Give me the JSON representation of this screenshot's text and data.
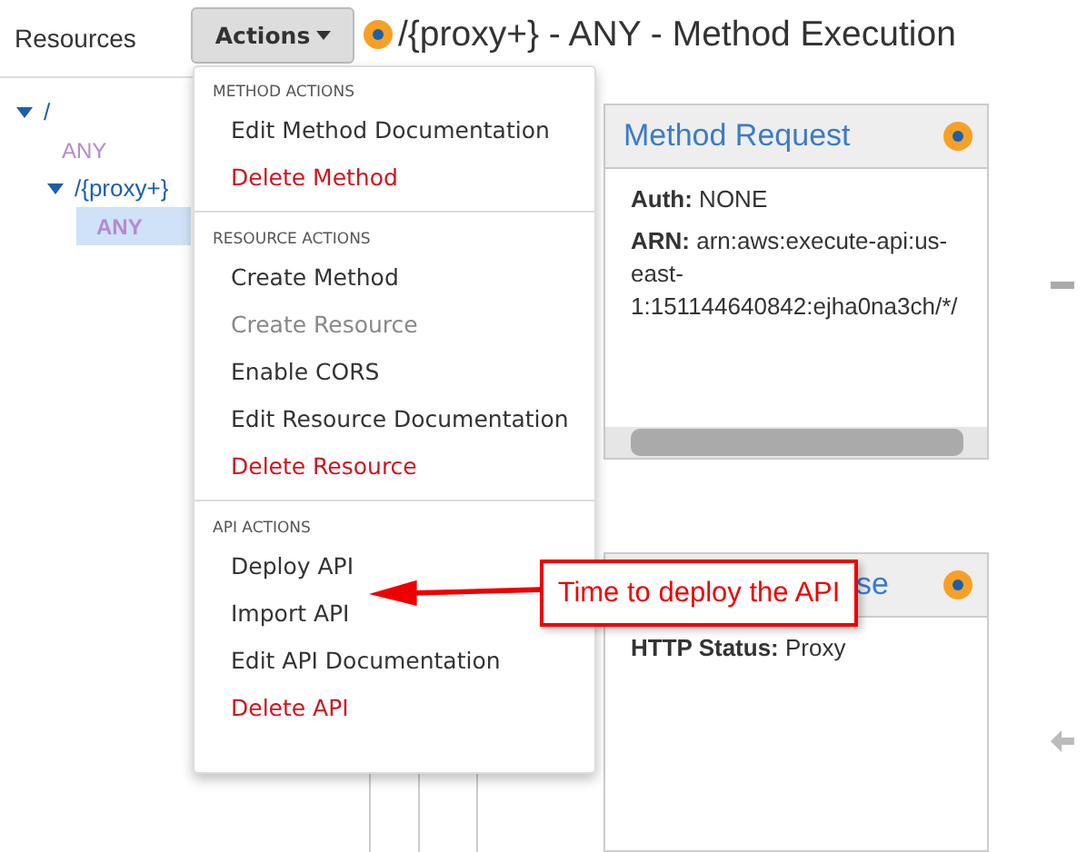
{
  "sidebar": {
    "title": "Resources",
    "tree": [
      {
        "label": "/",
        "kind": "resource",
        "expanded": true,
        "selected": false,
        "children": [
          {
            "label": "ANY",
            "kind": "method",
            "selected": false
          },
          {
            "label": "/{proxy+}",
            "kind": "resource",
            "expanded": true,
            "selected": false,
            "children": [
              {
                "label": "ANY",
                "kind": "method",
                "selected": true
              }
            ]
          }
        ]
      }
    ]
  },
  "actions_button": {
    "label": "Actions",
    "expanded": true
  },
  "page_title": "/{proxy+} - ANY - Method Execution",
  "actions_menu": [
    {
      "heading": "METHOD ACTIONS",
      "items": [
        {
          "label": "Edit Method Documentation",
          "danger": false,
          "disabled": false
        },
        {
          "label": "Delete Method",
          "danger": true,
          "disabled": false
        }
      ]
    },
    {
      "heading": "RESOURCE ACTIONS",
      "items": [
        {
          "label": "Create Method",
          "danger": false,
          "disabled": false
        },
        {
          "label": "Create Resource",
          "danger": false,
          "disabled": true
        },
        {
          "label": "Enable CORS",
          "danger": false,
          "disabled": false
        },
        {
          "label": "Edit Resource Documentation",
          "danger": false,
          "disabled": false
        },
        {
          "label": "Delete Resource",
          "danger": true,
          "disabled": false
        }
      ]
    },
    {
      "heading": "API ACTIONS",
      "items": [
        {
          "label": "Deploy API",
          "danger": false,
          "disabled": false
        },
        {
          "label": "Import API",
          "danger": false,
          "disabled": false
        },
        {
          "label": "Edit API Documentation",
          "danger": false,
          "disabled": false
        },
        {
          "label": "Delete API",
          "danger": true,
          "disabled": false
        }
      ]
    }
  ],
  "cards": [
    {
      "title": "Method Request",
      "fields": [
        "**Auth:** NONE",
        "**ARN:** arn:aws:execute-api:us-east-1:151144640842:ejha0na3ch/*/"
      ]
    },
    {
      "title": "se",
      "fields": [
        "**HTTP Status:** Proxy"
      ]
    }
  ],
  "callout": {
    "text": "Time to deploy the API"
  }
}
